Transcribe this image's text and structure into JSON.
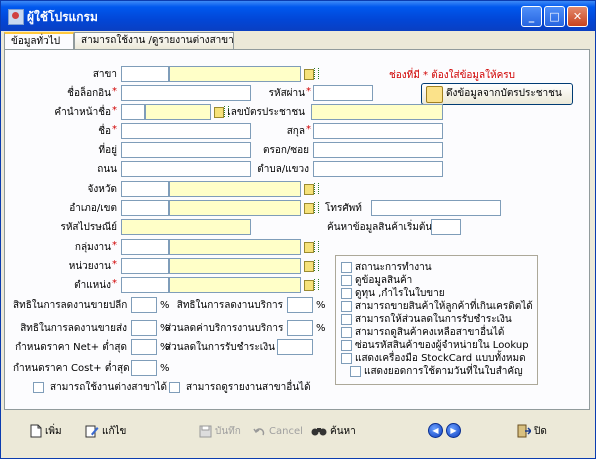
{
  "window": {
    "title": "ผู้ใช้โปรแกรม",
    "min": "_",
    "max": "□",
    "close": "✕"
  },
  "tabs": [
    {
      "label": "ข้อมูลทั่วไป"
    },
    {
      "label": "สามารถใช้งาน /ดูรายงานต่างสาขา"
    }
  ],
  "required_note": "ช่องที่มี * ต้องใส่ข้อมูลให้ครบ",
  "card_button": "ดึงข้อมูลจากบัตรประชาชน",
  "labels": {
    "branch": "สาขา",
    "login_name": "ชื่อล็อกอิน",
    "password": "รหัสผ่าน",
    "prefix": "คำนำหน้าชื่อ",
    "id_card": "เลขบัตรประชาชน",
    "first_name": "ชื่อ",
    "last_name": "สกุล",
    "address": "ที่อยู่",
    "alley": "ตรอก/ซอย",
    "road": "ถนน",
    "subdistrict": "ตำบล/แขวง",
    "province": "จังหวัด",
    "district": "อำเภอ/เขต",
    "phone": "โทรศัพท์",
    "postcode": "รหัสไปรษณีย์",
    "search_start": "ค้นหาข้อมูลสินค้าเริ่มต้น",
    "group": "กลุ่มงาน",
    "unit": "หน่วยงาน",
    "position": "ตำแหน่ง",
    "retail_discount": "สิทธิในการลดงานขายปลีก",
    "service_discount": "สิทธิในการลดงานบริการ",
    "wholesale_discount": "สิทธิในการลดงานขายส่ง",
    "service_fee_discount": "ส่วนลดค่าบริการงานบริการ",
    "min_net_price": "กำหนดราคา Net+ ต่ำสุด",
    "payment_discount": "ส่วนลดในการรับชำระเงิน",
    "min_cost_price": "กำหนดราคา Cost+ ต่ำสุด"
  },
  "required_mark": "*",
  "percent": "%",
  "values": {
    "retail_discount": "",
    "service_discount": "",
    "wholesale_discount": "",
    "service_fee_discount": "",
    "min_net_price": "",
    "payment_discount": "",
    "min_cost_price": ""
  },
  "bottom_checks": [
    {
      "label": "สามารถใช้งานต่างสาขาได้",
      "checked": false
    },
    {
      "label": "สามารถดูรายงานสาขาอื่นได้",
      "checked": false
    }
  ],
  "permissions": [
    {
      "label": "สถานะการทำงาน",
      "checked": false
    },
    {
      "label": "ดูข้อมูลสินค้า",
      "checked": false
    },
    {
      "label": "ดูทุน ,กำไรในใบขาย",
      "checked": false
    },
    {
      "label": "สามารถขายสินค้าให้ลูกค้าที่เกินเครดิตได้",
      "checked": false
    },
    {
      "label": "สามารถให้ส่วนลดในการรับชำระเงิน",
      "checked": false
    },
    {
      "label": "สามารถดูสินค้าคงเหลือสาขาอื่นได้",
      "checked": false
    },
    {
      "label": "ซ่อนรหัสสินค้าของผู้จำหน่ายใน Lookup",
      "checked": false
    },
    {
      "label": "แสดงเครื่องมือ StockCard แบบทั้งหมด",
      "checked": false
    },
    {
      "label": "แสดงยอดการใช้ตามวันที่ในใบสำคัญ",
      "checked": false
    }
  ],
  "toolbar": {
    "add": "เพิ่ม",
    "edit": "แก้ไข",
    "save": "บันทึก",
    "cancel": "Cancel",
    "search": "ค้นหา",
    "close": "ปิด"
  },
  "colors": {
    "required_field": "#ffffc8",
    "required_mark": "#d00000",
    "title_bar": "#0247d8"
  }
}
